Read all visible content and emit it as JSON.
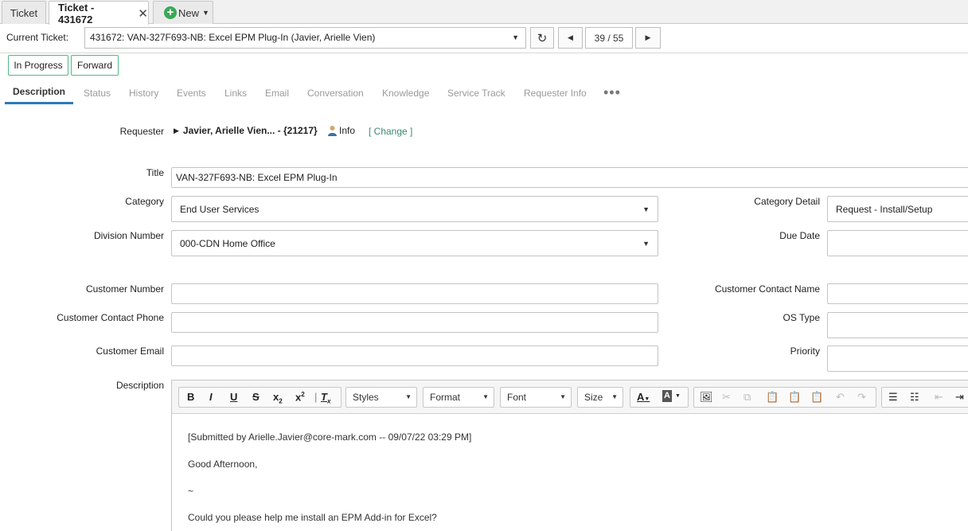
{
  "tabs": {
    "ticket": "Ticket",
    "current": "Ticket - 431672",
    "new": "New"
  },
  "current_ticket": {
    "label": "Current Ticket:",
    "value": "431672: VAN-327F693-NB: Excel EPM Plug-In (Javier, Arielle Vien)",
    "counter": "39 / 55"
  },
  "status_buttons": {
    "in_progress": "In Progress",
    "forward": "Forward"
  },
  "subtabs": [
    "Description",
    "Status",
    "History",
    "Events",
    "Links",
    "Email",
    "Conversation",
    "Knowledge",
    "Service Track",
    "Requester Info"
  ],
  "form": {
    "requester_label": "Requester",
    "requester_value": "Javier, Arielle Vien... - {21217}",
    "info_label": "Info",
    "change_label": "[ Change ]",
    "title_label": "Title",
    "title_value": "VAN-327F693-NB: Excel EPM Plug-In",
    "category_label": "Category",
    "category_value": "End User Services",
    "category_detail_label": "Category Detail",
    "category_detail_value": "Request - Install/Setup",
    "division_label": "Division Number",
    "division_value": "000-CDN Home Office",
    "due_date_label": "Due Date",
    "due_date_value": "",
    "customer_number_label": "Customer Number",
    "customer_number_value": "",
    "customer_contact_name_label": "Customer Contact Name",
    "customer_contact_name_value": "",
    "customer_contact_phone_label": "Customer Contact Phone",
    "customer_contact_phone_value": "",
    "os_type_label": "OS Type",
    "os_type_value": "",
    "customer_email_label": "Customer Email",
    "customer_email_value": "",
    "priority_label": "Priority",
    "priority_value": "",
    "description_label": "Description"
  },
  "editor": {
    "styles": "Styles",
    "format": "Format",
    "font": "Font",
    "size": "Size",
    "lines": [
      "[Submitted by Arielle.Javier@core-mark.com -- 09/07/22 03:29 PM]",
      "Good Afternoon,",
      "~",
      "Could you please help me install an EPM Add-in for Excel?"
    ]
  },
  "colors": {
    "accent_tab_underline": "#2b7bb9",
    "status_border": "#52b788",
    "new_plus": "#3aa857"
  }
}
